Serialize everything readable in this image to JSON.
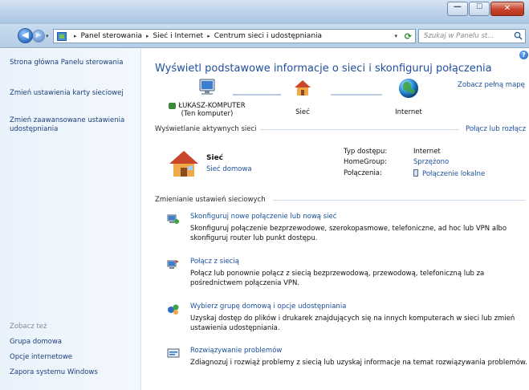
{
  "window": {
    "minimize_glyph": "—",
    "maximize_glyph": "☐",
    "close_glyph": "✕"
  },
  "nav": {
    "back_glyph": "◀",
    "forward_glyph": "▶",
    "recent_glyph": "▾",
    "breadcrumbs": [
      "Panel sterowania",
      "Sieć i Internet",
      "Centrum sieci i udostępniania"
    ],
    "crumb_sep": "▸",
    "search_placeholder": "Szukaj w Panelu st..."
  },
  "sidebar": {
    "links": [
      "Strona główna Panelu sterowania",
      "Zmień ustawienia karty sieciowej",
      "Zmień zaawansowane ustawienia udostępniania"
    ],
    "see_also_title": "Zobacz też",
    "see_also": [
      "Grupa domowa",
      "Opcje internetowe",
      "Zapora systemu Windows"
    ]
  },
  "main": {
    "title": "Wyświetl podstawowe informacje o sieci i skonfiguruj połączenia",
    "see_full_map": "Zobacz pełną mapę",
    "nodes": {
      "computer_name": "ŁUKASZ-KOMPUTER",
      "computer_sub": "(Ten komputer)",
      "network": "Sieć",
      "internet": "Internet"
    },
    "active_networks": {
      "label": "Wyświetlanie aktywnych sieci",
      "connect_link": "Połącz lub rozłącz",
      "network_name": "Sieć",
      "network_type": "Sieć domowa",
      "props": [
        {
          "label": "Typ dostępu:",
          "value": "Internet",
          "kind": "plain"
        },
        {
          "label": "HomeGroup:",
          "value": "Sprzężono",
          "kind": "link"
        },
        {
          "label": "Połączenia:",
          "value": "Połączenie lokalne",
          "kind": "link"
        }
      ]
    },
    "change_settings": {
      "label": "Zmienianie ustawień sieciowych",
      "tasks": [
        {
          "icon": "network-setup-icon",
          "link": "Skonfiguruj nowe połączenie lub nową sieć",
          "desc": "Skonfiguruj połączenie bezprzewodowe, szerokopasmowe, telefoniczne, ad hoc lub VPN albo skonfiguruj router lub punkt dostępu."
        },
        {
          "icon": "connect-network-icon",
          "link": "Połącz z siecią",
          "desc": "Połącz lub ponownie połącz z siecią bezprzewodową, przewodową, telefoniczną lub za pośrednictwem połączenia VPN."
        },
        {
          "icon": "homegroup-icon",
          "link": "Wybierz grupę domową i opcje udostępniania",
          "desc": "Uzyskaj dostęp do plików i drukarek znajdujących się na innych komputerach w sieci lub zmień ustawienia udostępniania."
        },
        {
          "icon": "troubleshoot-icon",
          "link": "Rozwiązywanie problemów",
          "desc": "Zdiagnozuj i rozwiąż problemy z siecią lub uzyskaj informacje na temat rozwiązywania problemów."
        }
      ]
    }
  },
  "colors": {
    "link": "#1b4f9c",
    "title": "#1f4e9a",
    "sidebar_bg": "#e9f2fb"
  }
}
